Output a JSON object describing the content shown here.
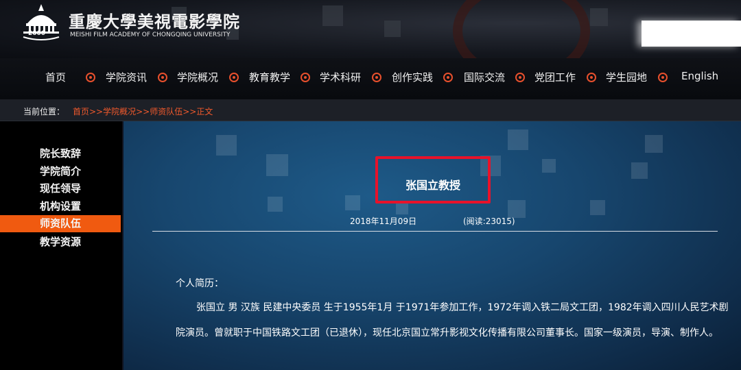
{
  "header": {
    "logo_cn": "重慶大學美視電影學院",
    "logo_en": "MEISHI FILM ACADEMY OF CHONGQING UNIVERSITY",
    "emblem_year": "2000"
  },
  "nav": {
    "items": [
      "首页",
      "学院资讯",
      "学院概况",
      "教育教学",
      "学术科研",
      "创作实践",
      "国际交流",
      "党团工作",
      "学生园地",
      "English"
    ],
    "bullet_color": "#e8502d"
  },
  "breadcrumb": {
    "label": "当前位置：",
    "path": "首页>>学院概况>>师资队伍>>正文",
    "link_color": "#f0592c"
  },
  "sidebar": {
    "items": [
      "院长致辞",
      "学院简介",
      "现任领导",
      "机构设置",
      "师资队伍",
      "教学资源"
    ],
    "active": "师资队伍",
    "active_color": "#f05a10"
  },
  "article": {
    "title": "张国立教授",
    "date": "2018年11月09日",
    "reads": "(阅读:23015)",
    "section_label": "个人简历：",
    "bio": "张国立 男 汉族 民建中央委员 生于1955年1月 于1971年参加工作，1972年调入铁二局文工团，1982年调入四川人民艺术剧院演员。曾就职于中国铁路文工团（已退休），现任北京国立常升影视文化传播有限公司董事长。国家一级演员，导演、制作人。",
    "highlight_color": "#e8122a"
  }
}
